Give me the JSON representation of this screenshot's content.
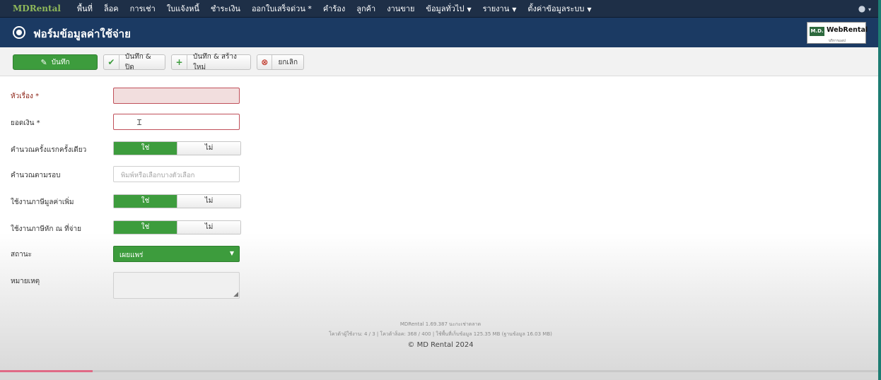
{
  "navbar": {
    "brand": "MDRental",
    "items": [
      {
        "label": "พื้นที่",
        "dropdown": false
      },
      {
        "label": "ล็อค",
        "dropdown": false
      },
      {
        "label": "การเช่า",
        "dropdown": false
      },
      {
        "label": "ใบแจ้งหนี้",
        "dropdown": false
      },
      {
        "label": "ชำระเงิน",
        "dropdown": false
      },
      {
        "label": "ออกใบเสร็จด่วน *",
        "dropdown": false
      },
      {
        "label": "คำร้อง",
        "dropdown": false
      },
      {
        "label": "ลูกค้า",
        "dropdown": false
      },
      {
        "label": "งานขาย",
        "dropdown": false
      },
      {
        "label": "ข้อมูลทั่วไป",
        "dropdown": true
      },
      {
        "label": "รายงาน",
        "dropdown": true
      },
      {
        "label": "ตั้งค่าข้อมูลระบบ",
        "dropdown": true
      }
    ],
    "user_icon": "user-icon"
  },
  "header": {
    "title": "ฟอร์มข้อมูลค่าใช้จ่าย",
    "title_icon": "radio-circle-icon",
    "logo": {
      "badge": "M.D.",
      "text": "WebRental",
      "sub": "บริการแอป"
    }
  },
  "toolbar": {
    "save_label": "บันทึก",
    "save_close_label": "บันทึก & ปิด",
    "save_new_label": "บันทึก & สร้างใหม่",
    "cancel_label": "ยกเลิก"
  },
  "form": {
    "title_label": "หัวเรื่อง *",
    "title_value": "",
    "amount_label": "ยอดเงิน *",
    "amount_value": "",
    "once_label": "คำนวณครั้งแรกครั้งเดียว",
    "yes": "ใช่",
    "no": "ไม่",
    "cycle_label": "คำนวณตามรอบ",
    "cycle_placeholder": "พิมพ์หรือเลือกบางตัวเลือก",
    "vat_label": "ใช้งานภาษีมูลค่าเพิ่ม",
    "wht_label": "ใช้งานภาษีหัก ณ ที่จ่าย",
    "status_label": "สถานะ",
    "status_value": "เผยแพร่",
    "note_label": "หมายเหตุ",
    "note_value": ""
  },
  "footer": {
    "version": "MDRental 1.69.387 นะกะเช่าตลาด",
    "stats": "โควต้าผู้ใช้งาน: 4 / 3 | โควต้าล็อค: 368 / 400 | ใช้พื้นที่เก็บข้อมูล 125.35 MB (ฐานข้อมูล 16.03 MB)",
    "copyright": "© MD Rental 2024"
  },
  "colors": {
    "navbar": "#1e2f47",
    "titlebar": "#1b3a63",
    "accent_green": "#3d9c3d",
    "brand_green": "#8fb85a",
    "invalid": "#c0505a"
  },
  "progress": {
    "value": 0.105
  }
}
